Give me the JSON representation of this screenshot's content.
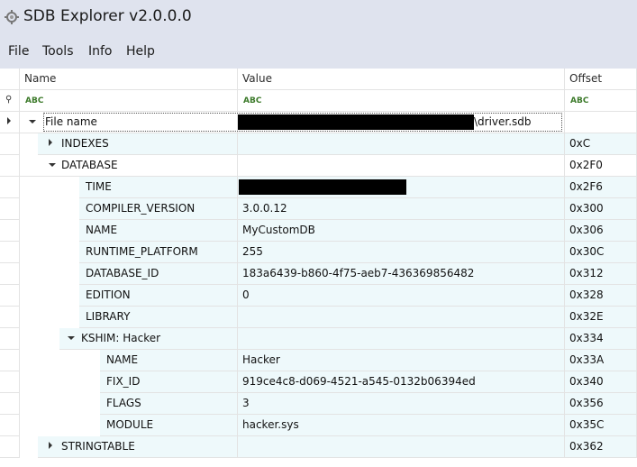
{
  "window": {
    "title": "SDB Explorer v2.0.0.0"
  },
  "menu": [
    "File",
    "Tools",
    "Info",
    "Help"
  ],
  "columns": {
    "name": "Name",
    "value": "Value",
    "offset": "Offset"
  },
  "filter_icon_text": "ABC",
  "rows": [
    {
      "name": "File name",
      "value": "\\driver.sdb",
      "offset": ""
    },
    {
      "name": "INDEXES",
      "value": "",
      "offset": "0xC"
    },
    {
      "name": "DATABASE",
      "value": "",
      "offset": "0x2F0"
    },
    {
      "name": "TIME",
      "value": "",
      "offset": "0x2F6"
    },
    {
      "name": "COMPILER_VERSION",
      "value": "3.0.0.12",
      "offset": "0x300"
    },
    {
      "name": "NAME",
      "value": "MyCustomDB",
      "offset": "0x306"
    },
    {
      "name": "RUNTIME_PLATFORM",
      "value": "255",
      "offset": "0x30C"
    },
    {
      "name": "DATABASE_ID",
      "value": "183a6439-b860-4f75-aeb7-436369856482",
      "offset": "0x312"
    },
    {
      "name": "EDITION",
      "value": "0",
      "offset": "0x328"
    },
    {
      "name": "LIBRARY",
      "value": "",
      "offset": "0x32E"
    },
    {
      "name": "KSHIM: Hacker",
      "value": "",
      "offset": "0x334"
    },
    {
      "name": "NAME",
      "value": "Hacker",
      "offset": "0x33A"
    },
    {
      "name": "FIX_ID",
      "value": "919ce4c8-d069-4521-a545-0132b06394ed",
      "offset": "0x340"
    },
    {
      "name": "FLAGS",
      "value": "3",
      "offset": "0x356"
    },
    {
      "name": "MODULE",
      "value": "hacker.sys",
      "offset": "0x35C"
    },
    {
      "name": "STRINGTABLE",
      "value": "",
      "offset": "0x362"
    }
  ]
}
